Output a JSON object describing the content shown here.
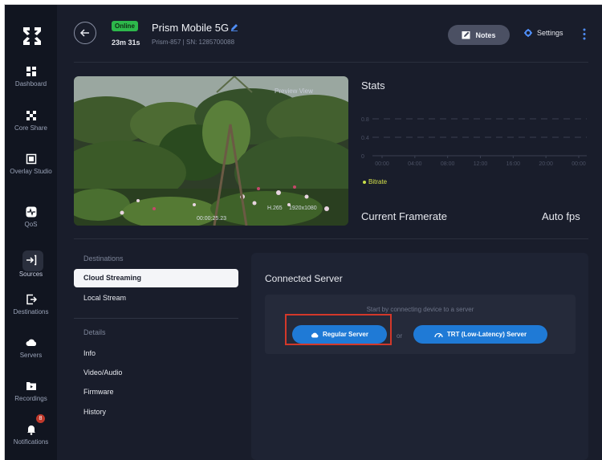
{
  "sidebar": {
    "items": [
      {
        "label": "Dashboard",
        "icon": "dashboard-icon"
      },
      {
        "label": "Core Share",
        "icon": "core-share-icon"
      },
      {
        "label": "Overlay Studio",
        "icon": "overlay-studio-icon"
      },
      {
        "label": "QoS",
        "icon": "qos-icon"
      },
      {
        "label": "Sources",
        "icon": "sources-icon"
      },
      {
        "label": "Destinations",
        "icon": "destinations-icon"
      },
      {
        "label": "Servers",
        "icon": "servers-icon"
      },
      {
        "label": "Recordings",
        "icon": "recordings-icon"
      },
      {
        "label": "Notifications",
        "icon": "bell-icon"
      }
    ],
    "notification_count": "8"
  },
  "header": {
    "status": "Online",
    "uptime": "23m 31s",
    "device_name": "Prism Mobile 5G",
    "device_sub": "Prism-857 | SN: 1285700088",
    "notes_label": "Notes",
    "settings_label": "Settings"
  },
  "video": {
    "timestamp": "00:00:25.23",
    "codec": "H.265",
    "resolution": "1920x1080",
    "preview_label": "Preview View"
  },
  "stats": {
    "title": "Stats",
    "legend": "Bitrate",
    "framerate_label": "Current Framerate",
    "framerate_value": "Auto fps"
  },
  "chart_data": {
    "type": "line",
    "x": [
      "00:00",
      "04:00",
      "08:00",
      "12:00",
      "16:00",
      "20:00",
      "00:00"
    ],
    "series": [
      {
        "name": "Bitrate",
        "values": []
      }
    ],
    "y_ticks": [
      "0.8",
      "0.4",
      "0"
    ],
    "grid": true,
    "colors": {
      "series": "#c9e04a"
    }
  },
  "subnav": {
    "destinations_heading": "Destinations",
    "destinations": [
      "Cloud Streaming",
      "Local Stream"
    ],
    "details_heading": "Details",
    "details": [
      "Info",
      "Video/Audio",
      "Firmware",
      "History"
    ]
  },
  "server": {
    "title": "Connected Server",
    "hint": "Start by connecting device to a server",
    "regular_label": "Regular Server",
    "or_label": "or",
    "trt_label": "TRT (Low-Latency) Server"
  },
  "colors": {
    "accent": "#1f7ad6",
    "online": "#2db84b",
    "sidebar_bg": "#111520",
    "main_bg": "#191d2b",
    "highlight": "#d3382a"
  }
}
